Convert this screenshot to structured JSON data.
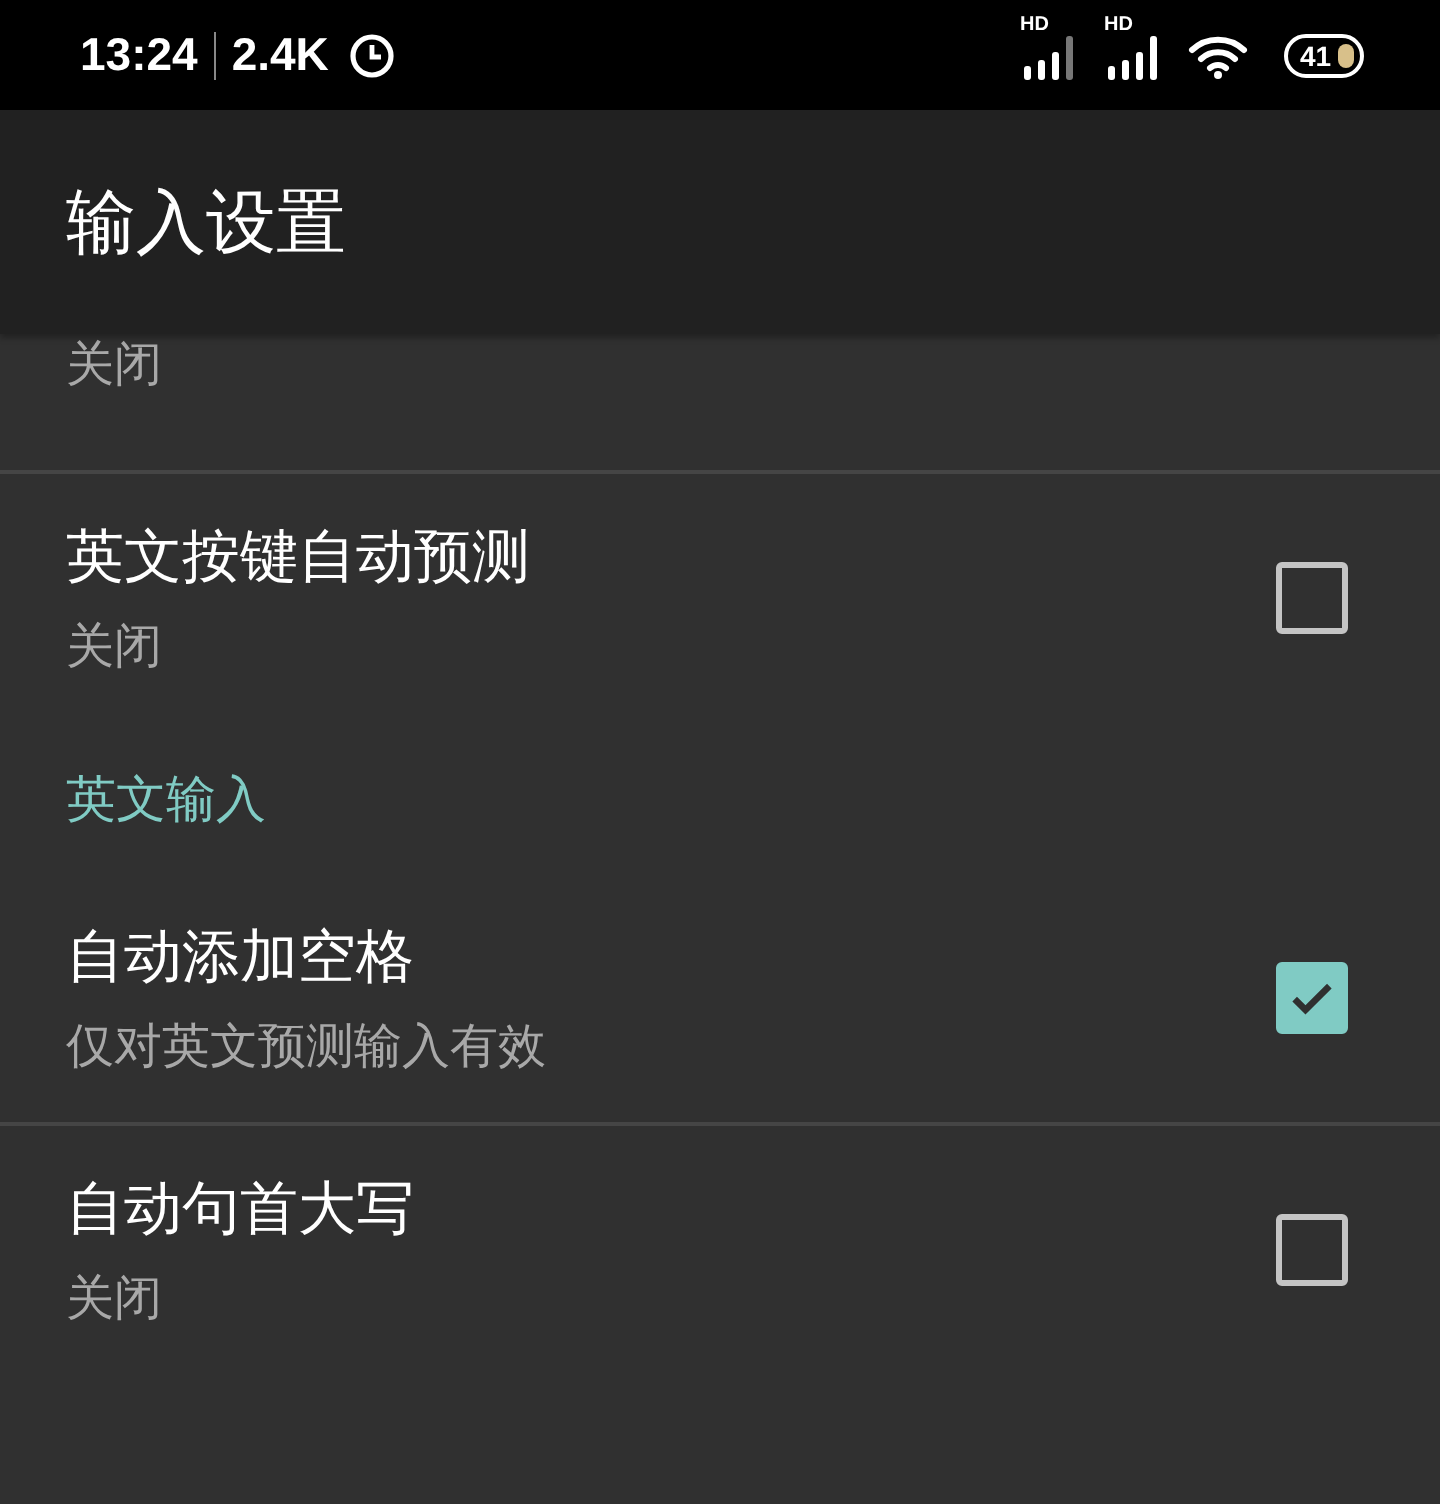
{
  "status_bar": {
    "time": "13:24",
    "speed": "2.4K",
    "signals": [
      {
        "label": "HD"
      },
      {
        "label": "HD"
      }
    ],
    "battery": "41"
  },
  "app_bar": {
    "title": "输入设置"
  },
  "cut_row": {
    "subtitle": "关闭"
  },
  "items": [
    {
      "kind": "setting",
      "title": "英文按键自动预测",
      "subtitle": "关闭",
      "checked": false,
      "divider_after": false
    },
    {
      "kind": "header",
      "title": "英文输入"
    },
    {
      "kind": "setting",
      "title": "自动添加空格",
      "subtitle": "仅对英文预测输入有效",
      "checked": true,
      "divider_after": true
    },
    {
      "kind": "setting",
      "title": "自动句首大写",
      "subtitle": "关闭",
      "checked": false,
      "divider_after": false
    }
  ]
}
